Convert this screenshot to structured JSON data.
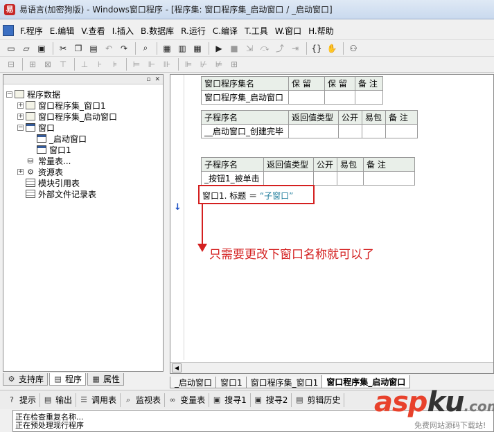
{
  "window": {
    "title": "易语言(加密狗版) - Windows窗口程序 - [程序集: 窗口程序集_启动窗口 / _启动窗口]",
    "app_icon": "易"
  },
  "menu": [
    "F.程序",
    "E.编辑",
    "V.查看",
    "I.插入",
    "B.数据库",
    "R.运行",
    "C.编译",
    "T.工具",
    "W.窗口",
    "H.帮助"
  ],
  "toolbar1": [
    {
      "icon": "new-file-icon",
      "glyph": "▭",
      "enabled": true
    },
    {
      "icon": "open-folder-icon",
      "glyph": "▱",
      "enabled": true
    },
    {
      "icon": "save-icon",
      "glyph": "▣",
      "enabled": true
    },
    {
      "icon": "cut-icon",
      "glyph": "✂",
      "enabled": true
    },
    {
      "icon": "copy-icon",
      "glyph": "❐",
      "enabled": true
    },
    {
      "icon": "paste-icon",
      "glyph": "▤",
      "enabled": true
    },
    {
      "icon": "undo-icon",
      "glyph": "↶",
      "enabled": false
    },
    {
      "icon": "redo-icon",
      "glyph": "↷",
      "enabled": true
    },
    {
      "icon": "find-icon",
      "glyph": "⌕",
      "enabled": true
    },
    {
      "icon": "layout-window-icon",
      "glyph": "▦",
      "enabled": true
    },
    {
      "icon": "layout-split-icon",
      "glyph": "▥",
      "enabled": true
    },
    {
      "icon": "layout-grid-icon",
      "glyph": "▦",
      "enabled": true
    },
    {
      "icon": "run-icon",
      "glyph": "▶",
      "enabled": true
    },
    {
      "icon": "stop-icon",
      "glyph": "■",
      "enabled": false
    },
    {
      "icon": "step-into-icon",
      "glyph": "⇲",
      "enabled": false
    },
    {
      "icon": "step-over-icon",
      "glyph": "⤼",
      "enabled": false
    },
    {
      "icon": "step-out-icon",
      "glyph": "⤴",
      "enabled": false
    },
    {
      "icon": "run-to-cursor-icon",
      "glyph": "⇥",
      "enabled": false
    },
    {
      "icon": "braces-icon",
      "glyph": "{}",
      "enabled": true
    },
    {
      "icon": "hand-icon",
      "glyph": "✋",
      "enabled": true
    },
    {
      "icon": "binoculars-icon",
      "glyph": "⚇",
      "enabled": true
    }
  ],
  "toolbar2_icons": [
    "align-left-icon",
    "align-center-icon",
    "align-right-icon",
    "align-top-icon",
    "align-middle-icon",
    "align-bottom-icon",
    "same-width-icon",
    "same-height-icon",
    "same-size-icon",
    "space-horizontal-icon",
    "space-vertical-icon",
    "center-horizontal-icon",
    "center-vertical-icon",
    "grid-icon"
  ],
  "left_panel": {
    "tree": [
      {
        "label": "程序数据",
        "icon": "book-icon",
        "level": 0,
        "expander": "−"
      },
      {
        "label": "窗口程序集_窗口1",
        "icon": "module-icon",
        "level": 1,
        "expander": "+"
      },
      {
        "label": "窗口程序集_启动窗口",
        "icon": "module-icon",
        "level": 1,
        "expander": "+"
      },
      {
        "label": "窗口",
        "icon": "window-icon",
        "level": 1,
        "expander": "−"
      },
      {
        "label": "_启动窗口",
        "icon": "window-icon",
        "level": 2,
        "expander": ""
      },
      {
        "label": "窗口1",
        "icon": "window-icon",
        "level": 2,
        "expander": ""
      },
      {
        "label": "常量表...",
        "icon": "constant-icon",
        "level": 1,
        "expander": ""
      },
      {
        "label": "资源表",
        "icon": "resource-icon",
        "level": 1,
        "expander": "+"
      },
      {
        "label": "模块引用表",
        "icon": "module-ref-icon",
        "level": 1,
        "expander": ""
      },
      {
        "label": "外部文件记录表",
        "icon": "file-record-icon",
        "level": 1,
        "expander": ""
      }
    ],
    "tabs": [
      {
        "label": "支持库",
        "icon": "library-icon"
      },
      {
        "label": "程序",
        "icon": "program-icon"
      },
      {
        "label": "属性",
        "icon": "properties-icon"
      }
    ]
  },
  "editor": {
    "assembly_table": {
      "headers": [
        "窗口程序集名",
        "保 留",
        "保 留",
        "备 注"
      ],
      "row": [
        "窗口程序集_启动窗口",
        "",
        "",
        ""
      ]
    },
    "sub1_table": {
      "headers": [
        "子程序名",
        "返回值类型",
        "公开",
        "易包",
        "备 注"
      ],
      "row": [
        "__启动窗口_创建完毕",
        "",
        "",
        "",
        ""
      ]
    },
    "sub2_table": {
      "headers": [
        "子程序名",
        "返回值类型",
        "公开",
        "易包",
        "备 注"
      ],
      "row": [
        "_按钮1_被单击",
        "",
        "",
        "",
        ""
      ]
    },
    "code_line": {
      "lhs": "窗口1. 标题 ＝",
      "rhs": "“子窗口”"
    },
    "annotation": "只需要更改下窗口名称就可以了",
    "cursor_marker": "↓"
  },
  "doc_tabs": [
    {
      "label": "_启动窗口",
      "active": false
    },
    {
      "label": "窗口1",
      "active": false
    },
    {
      "label": "窗口程序集_窗口1",
      "active": false
    },
    {
      "label": "窗口程序集_启动窗口",
      "active": true
    }
  ],
  "bottom_tabs": [
    {
      "label": "提示",
      "icon": "hint-icon",
      "glyph": "?"
    },
    {
      "label": "输出",
      "icon": "output-icon",
      "glyph": "▤"
    },
    {
      "label": "调用表",
      "icon": "call-table-icon",
      "glyph": "☰"
    },
    {
      "label": "监视表",
      "icon": "watch-icon",
      "glyph": "⌕"
    },
    {
      "label": "变量表",
      "icon": "variable-icon",
      "glyph": "∞"
    },
    {
      "label": "搜寻1",
      "icon": "search1-icon",
      "glyph": "▣"
    },
    {
      "label": "搜寻2",
      "icon": "search2-icon",
      "glyph": "▣"
    },
    {
      "label": "剪辑历史",
      "icon": "clip-history-icon",
      "glyph": "▤"
    }
  ],
  "output_lines": [
    "正在检查重复名称...",
    "正在预处理现行程序"
  ],
  "watermark": {
    "logo_asp": "asp",
    "logo_ku": "ku",
    "logo_dot": ".com",
    "subtitle": "免费网站源码下载站!"
  },
  "colors": {
    "annotation_red": "#d42020",
    "string_teal": "#1a7a9a",
    "table_header_bg": "#e9efe9",
    "cursor_blue": "#1a4fc4"
  }
}
